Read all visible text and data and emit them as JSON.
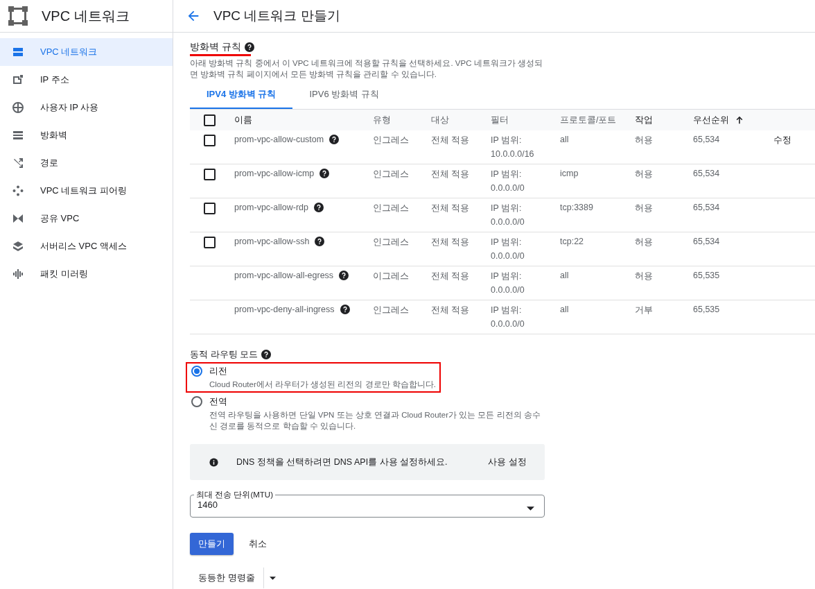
{
  "app": {
    "title": "VPC 네트워크"
  },
  "sidebar": {
    "items": [
      {
        "label": "VPC 네트워크",
        "selected": true
      },
      {
        "label": "IP 주소",
        "selected": false
      },
      {
        "label": "사용자 IP 사용",
        "selected": false
      },
      {
        "label": "방화벽",
        "selected": false
      },
      {
        "label": "경로",
        "selected": false
      },
      {
        "label": "VPC 네트워크 피어링",
        "selected": false
      },
      {
        "label": "공유 VPC",
        "selected": false
      },
      {
        "label": "서버리스 VPC 액세스",
        "selected": false
      },
      {
        "label": "패킷 미러링",
        "selected": false
      }
    ]
  },
  "page": {
    "title": "VPC 네트워크 만들기"
  },
  "firewall": {
    "heading": "방화벽 규칙",
    "description": "아래 방화벽 규칙 중에서 이 VPC 네트워크에 적용할 규칙을 선택하세요. VPC 네트워크가 생성되면 방화벽 규칙 페이지에서 모든 방화벽 규칙을 관리할 수 있습니다.",
    "tabs": [
      {
        "label": "IPV4 방화벽 규칙",
        "selected": true
      },
      {
        "label": "IPV6 방화벽 규칙",
        "selected": false
      }
    ],
    "table": {
      "select_all_checked": false,
      "columns": [
        "이름",
        "유형",
        "대상",
        "필터",
        "프로토콜/포트",
        "작업",
        "우선순위"
      ],
      "rows": [
        {
          "kind": "selectable",
          "checked": false,
          "name": "prom-vpc-allow-custom",
          "type": "인그레스",
          "target": "전체 적용",
          "filter_label": "IP 범위:",
          "filter_value": "10.0.0.0/16",
          "protocol": "all",
          "action": "허용",
          "priority": "65,534",
          "edit": "수정"
        },
        {
          "kind": "selectable",
          "checked": false,
          "name": "prom-vpc-allow-icmp",
          "type": "인그레스",
          "target": "전체 적용",
          "filter_label": "IP 범위:",
          "filter_value": "0.0.0.0/0",
          "protocol": "icmp",
          "action": "허용",
          "priority": "65,534"
        },
        {
          "kind": "selectable",
          "checked": false,
          "name": "prom-vpc-allow-rdp",
          "type": "인그레스",
          "target": "전체 적용",
          "filter_label": "IP 범위:",
          "filter_value": "0.0.0.0/0",
          "protocol": "tcp:3389",
          "action": "허용",
          "priority": "65,534"
        },
        {
          "kind": "selectable",
          "checked": false,
          "name": "prom-vpc-allow-ssh",
          "type": "인그레스",
          "target": "전체 적용",
          "filter_label": "IP 범위:",
          "filter_value": "0.0.0.0/0",
          "protocol": "tcp:22",
          "action": "허용",
          "priority": "65,534"
        },
        {
          "kind": "fixed",
          "name": "prom-vpc-allow-all-egress",
          "type": "이그레스",
          "target": "전체 적용",
          "filter_label": "IP 범위:",
          "filter_value": "0.0.0.0/0",
          "protocol": "all",
          "action": "허용",
          "priority": "65,535"
        },
        {
          "kind": "fixed",
          "name": "prom-vpc-deny-all-ingress",
          "type": "인그레스",
          "target": "전체 적용",
          "filter_label": "IP 범위:",
          "filter_value": "0.0.0.0/0",
          "protocol": "all",
          "action": "거부",
          "priority": "65,535"
        }
      ]
    }
  },
  "routing": {
    "heading": "동적 라우팅 모드",
    "options": [
      {
        "label": "리전",
        "description": "Cloud Router에서 라우터가 생성된 리전의 경로만 학습합니다.",
        "selected": true
      },
      {
        "label": "전역",
        "description": "전역 라우팅을 사용하면 단일 VPN 또는 상호 연결과 Cloud Router가 있는 모든 리전의 송수신 경로를 동적으로 학습할 수 있습니다.",
        "selected": false
      }
    ]
  },
  "dns_notice": {
    "message": "DNS 정책을 선택하려면 DNS API를 사용 설정하세요.",
    "action": "사용 설정"
  },
  "mtu": {
    "label": "최대 전송 단위(MTU)",
    "value": "1460"
  },
  "buttons": {
    "create": "만들기",
    "cancel": "취소"
  },
  "command_line": {
    "label": "동등한 명령줄"
  }
}
